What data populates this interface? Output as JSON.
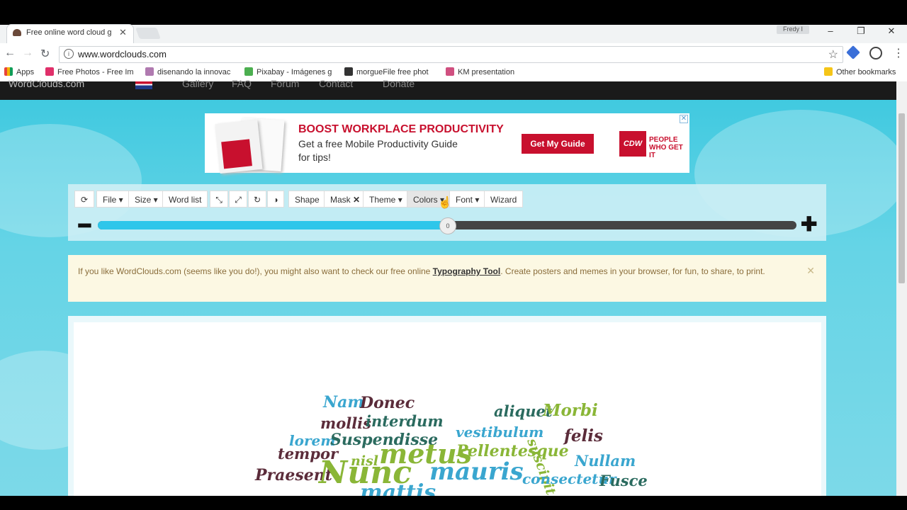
{
  "browser": {
    "tab_title": "Free online word cloud g",
    "user_name": "Fredy I",
    "url": "www.wordclouds.com",
    "bookmarks": [
      {
        "label": "Apps",
        "color": "#e8443a"
      },
      {
        "label": "Free Photos - Free Im",
        "color": "#e0306a"
      },
      {
        "label": "disenando la innovac",
        "color": "#b07ab0"
      },
      {
        "label": "Pixabay - Imágenes g",
        "color": "#4caf50"
      },
      {
        "label": "morgueFile free phot",
        "color": "#333333"
      },
      {
        "label": "KM presentation",
        "color": "#d05080"
      }
    ],
    "other_bookmarks": "Other bookmarks"
  },
  "site_nav": {
    "logo": "WordClouds.com",
    "items": [
      "Gallery",
      "FAQ",
      "Forum",
      "Contact",
      "Donate"
    ]
  },
  "ad": {
    "headline": "BOOST WORKPLACE PRODUCTIVITY",
    "body": "Get a free Mobile Productivity Guide for tips!",
    "cta": "Get My Guide",
    "brand": "CDW",
    "tagline": "PEOPLE WHO GET IT"
  },
  "toolbar": {
    "file": "File",
    "size": "Size",
    "word_list": "Word list",
    "shape": "Shape",
    "mask": "Mask",
    "theme": "Theme",
    "colors": "Colors",
    "font": "Font",
    "wizard": "Wizard",
    "slider_value": "0",
    "slider_fraction": 0.5
  },
  "notice": {
    "before": "If you like WordClouds.com (seems like you do!), you might also want to check our free online ",
    "link": "Typography Tool",
    "after": ". Create posters and memes in your browser, for fun, to share, to print."
  },
  "cloud_words": [
    {
      "text": "Nam",
      "color": "#3aa6cf"
    },
    {
      "text": "Donec",
      "color": "#5b2c3a"
    },
    {
      "text": "mollis",
      "color": "#5b2c3a"
    },
    {
      "text": "interdum",
      "color": "#2b6b5f"
    },
    {
      "text": "aliquet",
      "color": "#2b6b5f"
    },
    {
      "text": "Morbi",
      "color": "#8ab637"
    },
    {
      "text": "vestibulum",
      "color": "#3aa6cf"
    },
    {
      "text": "felis",
      "color": "#5b2c3a"
    },
    {
      "text": "suscipit",
      "color": "#8ab637"
    },
    {
      "text": "lorem",
      "color": "#3aa6cf"
    },
    {
      "text": "Suspendisse",
      "color": "#2b6b5f"
    },
    {
      "text": "tempor",
      "color": "#5b2c3a"
    },
    {
      "text": "metus",
      "color": "#8ab637"
    },
    {
      "text": "Pellentesque",
      "color": "#8ab637"
    },
    {
      "text": "Nullam",
      "color": "#3aa6cf"
    },
    {
      "text": "nisl",
      "color": "#8ab637"
    },
    {
      "text": "Praesent",
      "color": "#5b2c3a"
    },
    {
      "text": "Nunc",
      "color": "#8ab637"
    },
    {
      "text": "mauris",
      "color": "#3aa6cf"
    },
    {
      "text": "consectetur",
      "color": "#3aa6cf"
    },
    {
      "text": "Fusce",
      "color": "#2b6b5f"
    },
    {
      "text": "mattis",
      "color": "#3aa6cf"
    }
  ]
}
